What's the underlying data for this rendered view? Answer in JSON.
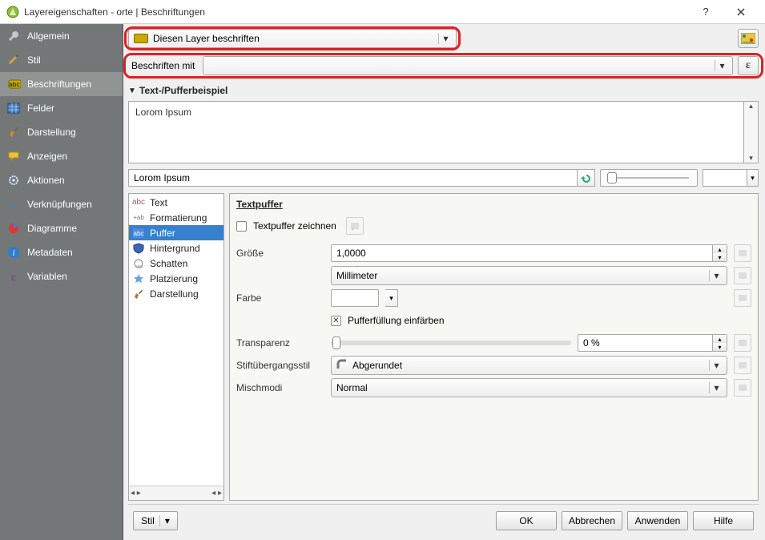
{
  "window": {
    "title": "Layereigenschaften - orte | Beschriftungen"
  },
  "sidebar": {
    "items": [
      {
        "label": "Allgemein"
      },
      {
        "label": "Stil"
      },
      {
        "label": "Beschriftungen"
      },
      {
        "label": "Felder"
      },
      {
        "label": "Darstellung"
      },
      {
        "label": "Anzeigen"
      },
      {
        "label": "Aktionen"
      },
      {
        "label": "Verknüpfungen"
      },
      {
        "label": "Diagramme"
      },
      {
        "label": "Metadaten"
      },
      {
        "label": "Variablen"
      }
    ],
    "active_index": 2
  },
  "top": {
    "label_mode": "Diesen Layer beschriften",
    "beschriften_mit_label": "Beschriften mit",
    "beschriften_mit_value": ""
  },
  "preview": {
    "section": "Text-/Pufferbeispiel",
    "sample": "Lorom Ipsum",
    "sample2": "Lorom Ipsum"
  },
  "categories": [
    {
      "label": "Text"
    },
    {
      "label": "Formatierung"
    },
    {
      "label": "Puffer"
    },
    {
      "label": "Hintergrund"
    },
    {
      "label": "Schatten"
    },
    {
      "label": "Platzierung"
    },
    {
      "label": "Darstellung"
    }
  ],
  "props": {
    "heading": "Textpuffer",
    "draw_label": "Textpuffer zeichnen",
    "size_label": "Größe",
    "size_value": "1,0000",
    "unit": "Millimeter",
    "color_label": "Farbe",
    "fill_label": "Pufferfüllung einfärben",
    "transp_label": "Transparenz",
    "transp_value": "0 %",
    "pen_label": "Stiftübergangsstil",
    "pen_value": "Abgerundet",
    "blend_label": "Mischmodi",
    "blend_value": "Normal"
  },
  "buttons": {
    "stil": "Stil",
    "ok": "OK",
    "cancel": "Abbrechen",
    "apply": "Anwenden",
    "help": "Hilfe"
  }
}
